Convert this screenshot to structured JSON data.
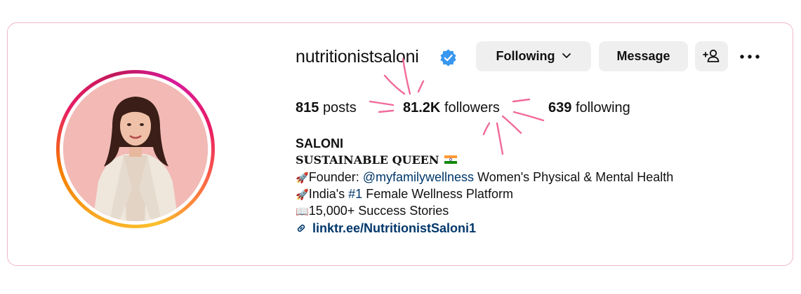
{
  "profile": {
    "username": "nutritionistsaloni",
    "verified": true,
    "accent_color": "#3897f0"
  },
  "actions": {
    "following_label": "Following",
    "message_label": "Message",
    "add_user_icon": "add-user-icon",
    "more_icon": "more-options-icon"
  },
  "stats": {
    "posts_count": "815",
    "posts_label": "posts",
    "followers_count": "81.2K",
    "followers_label": "followers",
    "following_count": "639",
    "following_label": "following"
  },
  "bio": {
    "name": "SALONI",
    "tagline": "SUSTAINABLE QUEEN",
    "line1_prefix": "Founder: ",
    "line1_mention": "@myfamilywellness",
    "line1_suffix": " Women's Physical & Mental Health",
    "line2_prefix": "India's ",
    "line2_hashtag": "#1",
    "line2_suffix": " Female Wellness Platform",
    "line3": "15,000+ Success Stories",
    "link": "linktr.ee/NutritionistSaloni1"
  },
  "colors": {
    "card_border": "#f0b7c8",
    "button_bg": "#efefef",
    "link": "#00376b",
    "sparkle": "#f06a9b"
  }
}
